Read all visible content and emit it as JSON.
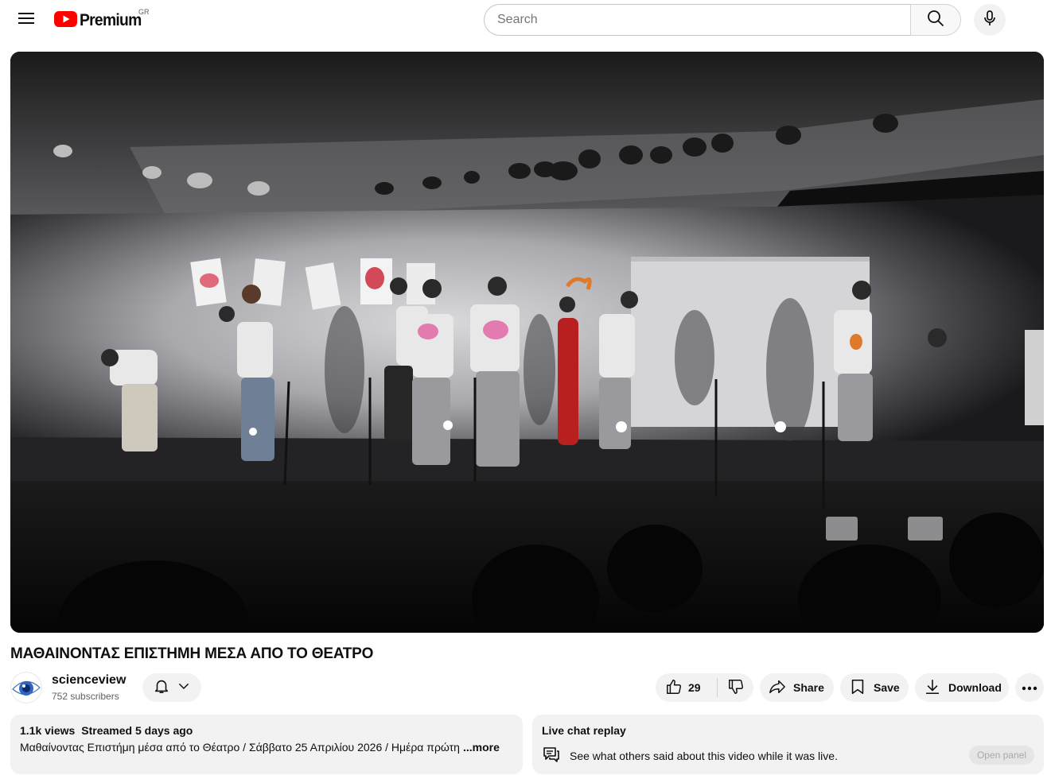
{
  "header": {
    "logo_text": "Premium",
    "country_code": "GR",
    "search_placeholder": "Search"
  },
  "video": {
    "title": "ΜΑΘΑΙΝΟΝΤΑΣ ΕΠΙΣΤΗΜΗ ΜΕΣΑ ΑΠΟ ΤΟ ΘΕΑΤΡΟ"
  },
  "channel": {
    "name": "scienceview",
    "subscribers": "752 subscribers"
  },
  "actions": {
    "like_count": "29",
    "share_label": "Share",
    "save_label": "Save",
    "download_label": "Download"
  },
  "description": {
    "views": "1.1k views",
    "streamed": "Streamed 5 days ago",
    "text": "Μαθαίνοντας Επιστήμη μέσα από το Θέατρο / Σάββατο 25 Απριλίου 2026 / Ημέρα πρώτη",
    "more_label": "...more"
  },
  "live_chat": {
    "title": "Live chat replay",
    "subtitle": "See what others said about this video while it was live.",
    "open_panel_label": "Open panel"
  },
  "icons": {
    "menu": "menu-icon",
    "logo": "youtube-logo-icon",
    "search": "search-icon",
    "mic": "microphone-icon",
    "bell": "bell-icon",
    "chevron": "chevron-down-icon",
    "like": "thumbs-up-icon",
    "dislike": "thumbs-down-icon",
    "share": "share-icon",
    "save": "bookmark-icon",
    "download": "download-icon",
    "more": "more-horizontal-icon",
    "chat": "chat-icon"
  },
  "colors": {
    "brand_red": "#ff0000",
    "chip_bg": "#f2f2f2",
    "text_primary": "#0f0f0f",
    "text_secondary": "#606060"
  }
}
